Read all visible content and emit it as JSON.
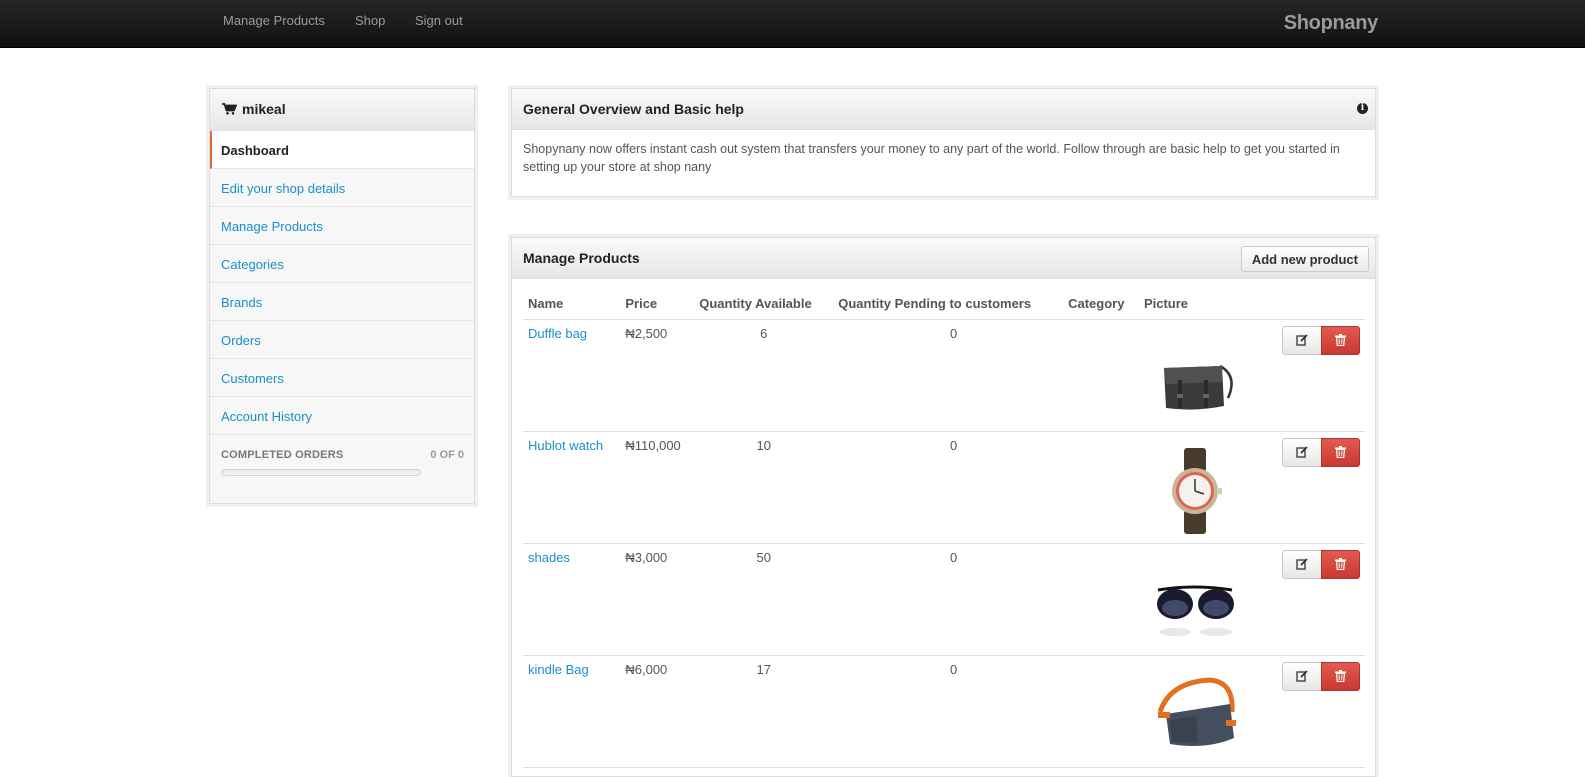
{
  "navbar": {
    "links": [
      "Manage Products",
      "Shop",
      "Sign out"
    ],
    "brand": "Shopnany"
  },
  "sidebar": {
    "title": "mikeal",
    "items": [
      {
        "label": "Dashboard",
        "active": true
      },
      {
        "label": "Edit your shop details"
      },
      {
        "label": "Manage Products"
      },
      {
        "label": "Categories"
      },
      {
        "label": "Brands"
      },
      {
        "label": "Orders"
      },
      {
        "label": "Customers"
      },
      {
        "label": "Account History"
      }
    ],
    "footer": {
      "label": "COMPLETED ORDERS",
      "count": "0 OF 0",
      "progress": 0
    }
  },
  "overview": {
    "title": "General Overview and Basic help",
    "body": "Shopynany now offers instant cash out system that transfers your money to any part of the world. Follow through are basic help to get you started in setting up your store at shop nany"
  },
  "products": {
    "title": "Manage Products",
    "add_label": "Add new product",
    "columns": [
      "Name",
      "Price",
      "Quantity Available",
      "Quantity Pending to customers",
      "Category",
      "Picture"
    ],
    "rows": [
      {
        "name": "Duffle bag",
        "price": "₦2,500",
        "qty": "6",
        "pending": "0",
        "category": "",
        "picture": "bag-picture"
      },
      {
        "name": "Hublot watch",
        "price": "₦110,000",
        "qty": "10",
        "pending": "0",
        "category": "",
        "picture": "watch-picture"
      },
      {
        "name": "shades",
        "price": "₦3,000",
        "qty": "50",
        "pending": "0",
        "category": "",
        "picture": "sunglasses-picture"
      },
      {
        "name": "kindle Bag",
        "price": "₦6,000",
        "qty": "17",
        "pending": "0",
        "category": "",
        "picture": "shoulder-bag-picture"
      }
    ]
  },
  "colors": {
    "link": "#1a8fc9",
    "danger": "#c8392f",
    "accent": "#e46a2b"
  }
}
